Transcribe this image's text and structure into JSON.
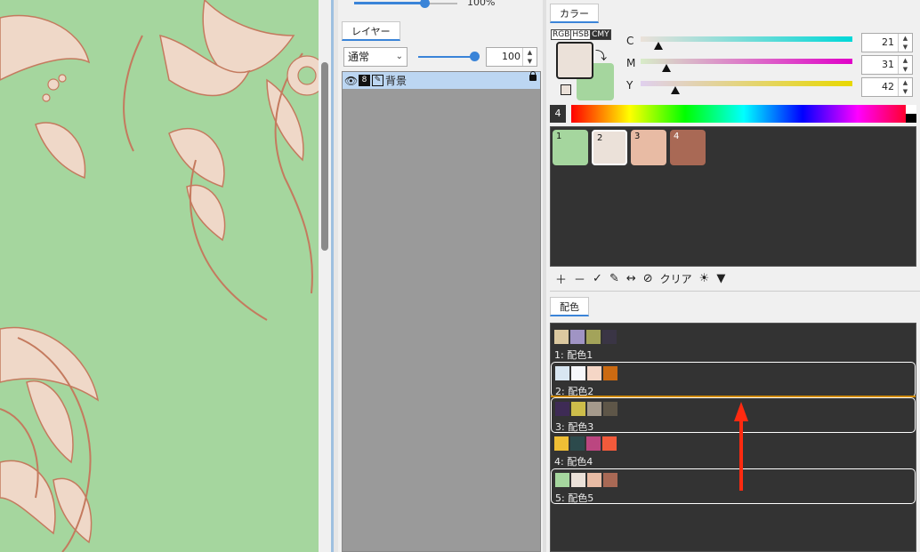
{
  "layer_panel": {
    "top_percent": "100%",
    "tab": "レイヤー",
    "blend_mode": "通常",
    "opacity": "100",
    "layer": {
      "name": "背景",
      "icon_box": "8",
      "icon_pen": "✎"
    }
  },
  "color_panel": {
    "tab": "カラー",
    "modes": [
      "RGB",
      "HSB",
      "CMY"
    ],
    "fg_color": "#ebe1d9",
    "bg_color": "#a5d69e",
    "cmy": [
      {
        "label": "C",
        "value": "21",
        "fraction": 0.082
      },
      {
        "label": "M",
        "value": "31",
        "fraction": 0.122
      },
      {
        "label": "Y",
        "value": "42",
        "fraction": 0.165
      }
    ],
    "hue_number": "4",
    "palette": [
      {
        "label": "1",
        "color": "#a5d69e"
      },
      {
        "label": "2",
        "color": "#ebe1d9",
        "selected": true
      },
      {
        "label": "3",
        "color": "#e8bba4"
      },
      {
        "label": "4",
        "color": "#a96955"
      }
    ],
    "palette_toolbar": {
      "clear": "クリア"
    }
  },
  "scheme_panel": {
    "tab": "配色",
    "schemes": [
      {
        "label": "1: 配色1",
        "colors": [
          "#dcc9a0",
          "#a094c4",
          "#a3a35a",
          "#3a3545"
        ]
      },
      {
        "label": "2: 配色2",
        "colors": [
          "#d8e6f2",
          "#f6f7fb",
          "#f5d6c6",
          "#cb6a12"
        ],
        "selected": true
      },
      {
        "label": "3: 配色3",
        "colors": [
          "#3e2b55",
          "#cdbd4a",
          "#a59a8c",
          "#5e5648"
        ],
        "selected": true
      },
      {
        "label": "4: 配色4",
        "colors": [
          "#efbe35",
          "#2c4a4c",
          "#bb4680",
          "#f25a3b"
        ]
      },
      {
        "label": "5: 配色5",
        "colors": [
          "#a5d69e",
          "#ebe1d9",
          "#e8bba4",
          "#a96955"
        ],
        "selected": true
      }
    ]
  }
}
